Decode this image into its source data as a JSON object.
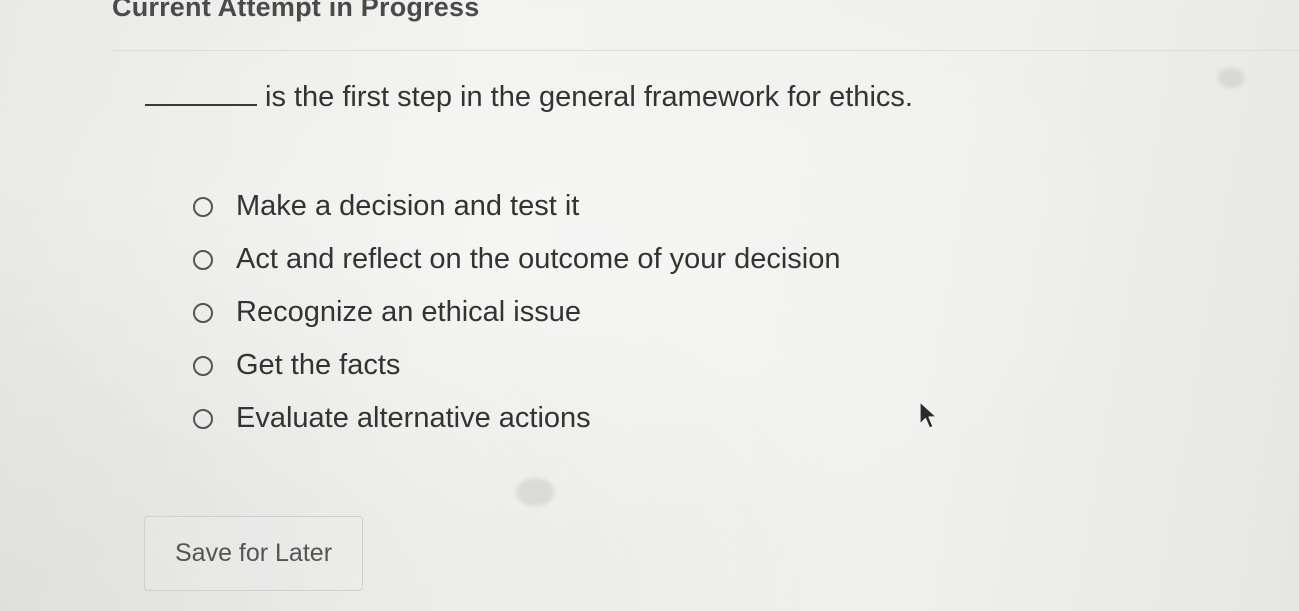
{
  "header": {
    "title": "Current Attempt in Progress"
  },
  "question": {
    "text": "is the first step in the general framework for ethics."
  },
  "options": [
    {
      "label": "Make a decision and test it"
    },
    {
      "label": "Act and reflect on the outcome of your decision"
    },
    {
      "label": "Recognize an ethical issue"
    },
    {
      "label": "Get the facts"
    },
    {
      "label": "Evaluate alternative actions"
    }
  ],
  "actions": {
    "save_label": "Save for Later"
  },
  "icons": {
    "radio": "radio-unselected-icon",
    "cursor": "mouse-pointer-icon"
  }
}
